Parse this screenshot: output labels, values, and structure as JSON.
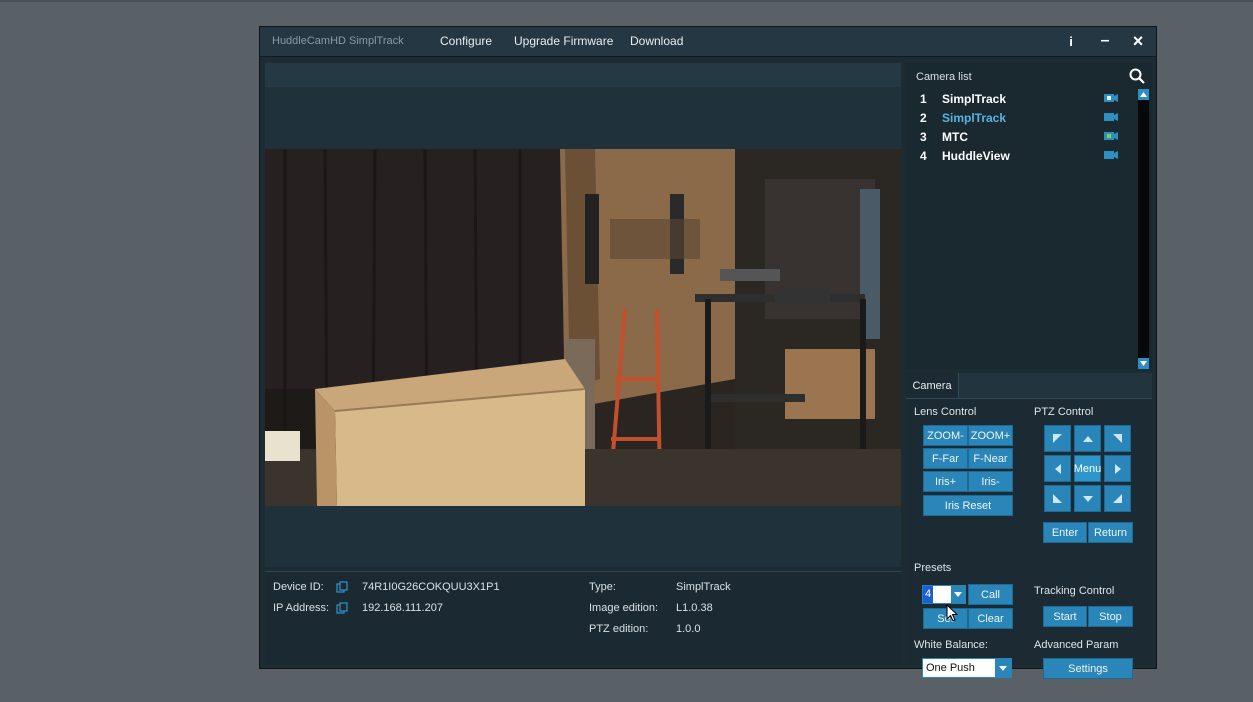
{
  "app": {
    "title": "HuddleCamHD SimplTrack",
    "menu": [
      "Configure",
      "Upgrade Firmware",
      "Download"
    ],
    "info_button": "i",
    "minimize_button": "–",
    "close_button": "×"
  },
  "device_info": {
    "device_id_label": "Device ID:",
    "device_id": "74R1I0G26COKQUU3X1P1",
    "ip_label": "IP Address:",
    "ip": "192.168.111.207",
    "type_label": "Type:",
    "type": "SimplTrack",
    "image_edition_label": "Image edition:",
    "image_edition": "L1.0.38",
    "ptz_edition_label": "PTZ edition:",
    "ptz_edition": "1.0.0"
  },
  "camera_list": {
    "title": "Camera list",
    "items": [
      {
        "num": "1",
        "name": "SimplTrack",
        "selected": false,
        "icon": "camera-icon-selected"
      },
      {
        "num": "2",
        "name": "SimplTrack",
        "selected": true,
        "icon": "camera-icon"
      },
      {
        "num": "3",
        "name": "MTC",
        "selected": false,
        "icon": "camera-icon-green"
      },
      {
        "num": "4",
        "name": "HuddleView",
        "selected": false,
        "icon": "camera-icon"
      }
    ]
  },
  "controls": {
    "tab": "Camera",
    "lens_control_label": "Lens Control",
    "zoom_minus": "ZOOM-",
    "zoom_plus": "ZOOM+",
    "f_far": "F-Far",
    "f_near": "F-Near",
    "iris_plus": "Iris+",
    "iris_minus": "Iris-",
    "iris_reset": "Iris Reset",
    "ptz_control_label": "PTZ Control",
    "menu": "Menu",
    "enter": "Enter",
    "return": "Return",
    "presets_label": "Presets",
    "preset_value": "4",
    "call": "Call",
    "set": "Set",
    "clear": "Clear",
    "tracking_control_label": "Tracking Control",
    "start": "Start",
    "stop": "Stop",
    "white_balance_label": "White Balance:",
    "white_balance_value": "One Push",
    "advanced_param_label": "Advanced Param",
    "settings": "Settings"
  },
  "colors": {
    "accent": "#2a85b8",
    "selected_camera": "#5ab3df",
    "window_bg": "#1d2b33"
  }
}
